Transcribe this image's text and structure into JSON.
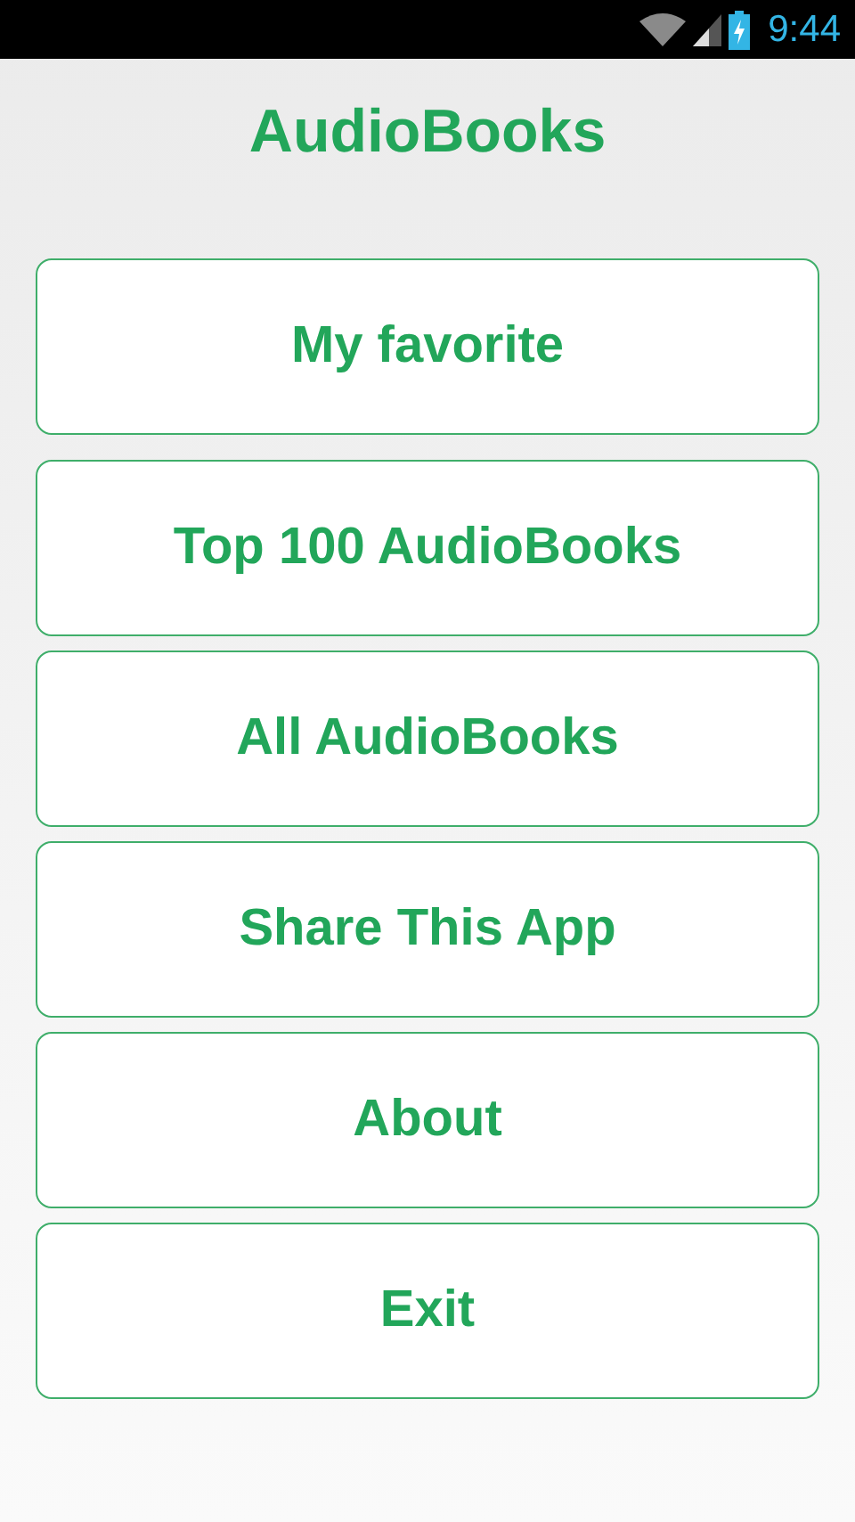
{
  "status_bar": {
    "time": "9:44"
  },
  "title": "AudioBooks",
  "menu": [
    {
      "label": "My favorite"
    },
    {
      "label": "Top 100 AudioBooks"
    },
    {
      "label": "All AudioBooks"
    },
    {
      "label": "Share This App"
    },
    {
      "label": "About"
    },
    {
      "label": "Exit"
    }
  ]
}
